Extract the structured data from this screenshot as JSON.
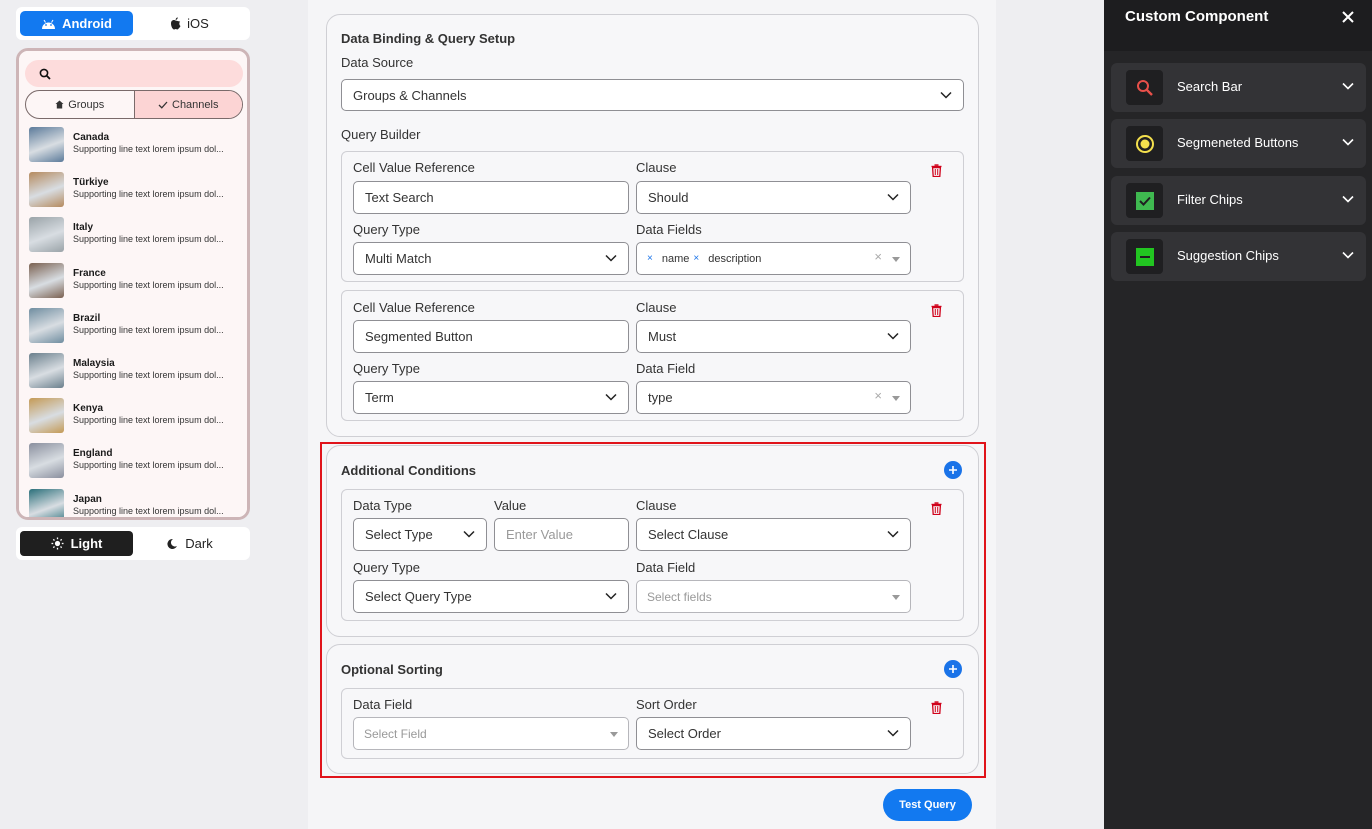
{
  "preview": {
    "platforms": [
      "Android",
      "iOS"
    ],
    "active_platform": "Android",
    "segments": [
      "Groups",
      "Channels"
    ],
    "active_segment": "Channels",
    "items": [
      {
        "title": "Canada",
        "subtitle": "Supporting line text lorem ipsum dol...",
        "color": "#5b7a9a"
      },
      {
        "title": "Türkiye",
        "subtitle": "Supporting line text lorem ipsum dol...",
        "color": "#b58a5e"
      },
      {
        "title": "Italy",
        "subtitle": "Supporting line text lorem ipsum dol...",
        "color": "#9aa3a8"
      },
      {
        "title": "France",
        "subtitle": "Supporting line text lorem ipsum dol...",
        "color": "#7a6050"
      },
      {
        "title": "Brazil",
        "subtitle": "Supporting line text lorem ipsum dol...",
        "color": "#6f8da0"
      },
      {
        "title": "Malaysia",
        "subtitle": "Supporting line text lorem ipsum dol...",
        "color": "#6a7f8c"
      },
      {
        "title": "Kenya",
        "subtitle": "Supporting line text lorem ipsum dol...",
        "color": "#c49a55"
      },
      {
        "title": "England",
        "subtitle": "Supporting line text lorem ipsum dol...",
        "color": "#8a8f9e"
      },
      {
        "title": "Japan",
        "subtitle": "Supporting line text lorem ipsum dol...",
        "color": "#2a6f7a"
      }
    ],
    "themes": [
      "Light",
      "Dark"
    ],
    "active_theme": "Light"
  },
  "setup": {
    "title": "Data Binding & Query Setup",
    "data_source_label": "Data Source",
    "data_source_value": "Groups & Channels",
    "query_builder_label": "Query Builder",
    "q1": {
      "cell_label": "Cell Value Reference",
      "cell_value": "Text Search",
      "clause_label": "Clause",
      "clause_value": "Should",
      "qtype_label": "Query Type",
      "qtype_value": "Multi Match",
      "fields_label": "Data Fields",
      "chips": [
        "name",
        "description"
      ]
    },
    "q2": {
      "cell_label": "Cell Value Reference",
      "cell_value": "Segmented Button",
      "clause_label": "Clause",
      "clause_value": "Must",
      "qtype_label": "Query Type",
      "qtype_value": "Term",
      "field_label": "Data Field",
      "field_value": "type"
    }
  },
  "additional": {
    "title": "Additional Conditions",
    "data_type_label": "Data Type",
    "data_type_value": "Select Type",
    "value_label": "Value",
    "value_placeholder": "Enter Value",
    "clause_label": "Clause",
    "clause_value": "Select Clause",
    "qtype_label": "Query Type",
    "qtype_value": "Select Query Type",
    "field_label": "Data Field",
    "field_placeholder": "Select fields"
  },
  "sorting": {
    "title": "Optional Sorting",
    "field_label": "Data Field",
    "field_placeholder": "Select Field",
    "order_label": "Sort Order",
    "order_value": "Select Order"
  },
  "test_button": "Test Query",
  "sidebar": {
    "title": "Custom Component",
    "items": [
      {
        "label": "Search Bar",
        "icon": "search-icon"
      },
      {
        "label": "Segmeneted Buttons",
        "icon": "radio-icon"
      },
      {
        "label": "Filter Chips",
        "icon": "checkbox-icon"
      },
      {
        "label": "Suggestion Chips",
        "icon": "minus-box-icon"
      }
    ]
  },
  "colors": {
    "accent": "#1279f0",
    "highlight": "#e0131a",
    "danger": "#d0021b"
  }
}
